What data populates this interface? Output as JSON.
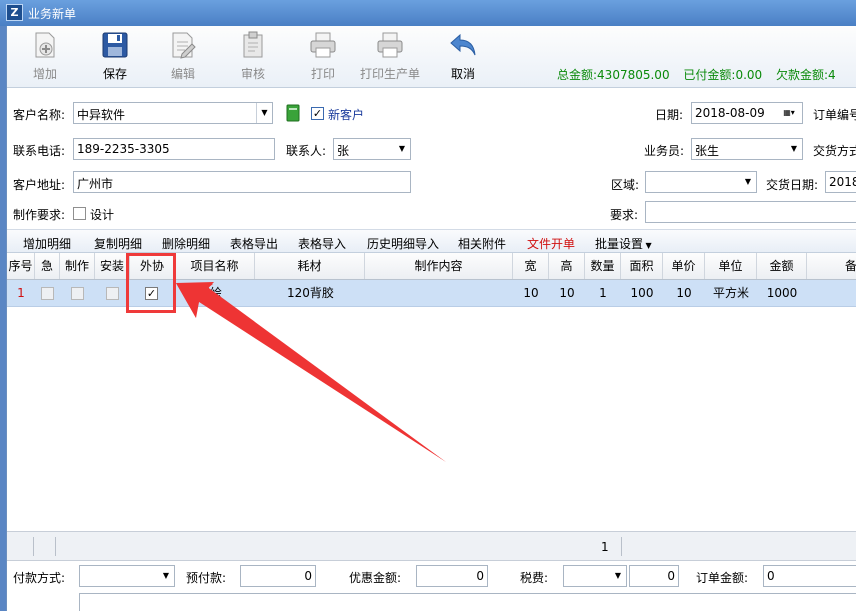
{
  "window": {
    "title": "业务新单",
    "app_icon": "Z"
  },
  "toolbar": {
    "add": "增加",
    "save": "保存",
    "edit": "编辑",
    "review": "审核",
    "print": "打印",
    "print_production": "打印生产单",
    "cancel": "取消"
  },
  "totals": {
    "total_label": "总金额:",
    "total_value": "4307805.00",
    "paid_label": "已付金额:",
    "paid_value": "0.00",
    "owed_label": "欠款金额:",
    "owed_value": "4"
  },
  "form": {
    "customer_name_label": "客户名称:",
    "customer_name": "中异软件",
    "new_customer_label": "新客户",
    "date_label": "日期:",
    "date": "2018-08-09",
    "order_no_label": "订单编号",
    "phone_label": "联系电话:",
    "phone": "189-2235-3305",
    "contact_label": "联系人:",
    "contact": "张",
    "salesman_label": "业务员:",
    "salesman": "张生",
    "delivery_method_label": "交货方式",
    "address_label": "客户地址:",
    "address": "广州市",
    "region_label": "区域:",
    "region": "",
    "delivery_date_label": "交货日期:",
    "delivery_date": "2018",
    "make_req_label": "制作要求:",
    "design_label": "设计",
    "requirement_label": "要求:",
    "requirement": ""
  },
  "subtoolbar": {
    "add_detail": "增加明细",
    "copy_detail": "复制明细",
    "delete_detail": "删除明细",
    "export_table": "表格导出",
    "import_table": "表格导入",
    "import_history": "历史明细导入",
    "attachments": "相关附件",
    "file_order": "文件开单",
    "batch_settings": "批量设置"
  },
  "grid": {
    "headers": {
      "seq": "序号",
      "urgent": "急",
      "make": "制作",
      "install": "安装",
      "outsource": "外协",
      "item": "项目名称",
      "material": "耗材",
      "content": "制作内容",
      "width": "宽",
      "height": "高",
      "qty": "数量",
      "area": "面积",
      "price": "单价",
      "unit": "单位",
      "amount": "金额",
      "remark": "备"
    },
    "rows": [
      {
        "seq": "1",
        "urgent": false,
        "make": false,
        "install": false,
        "outsource": true,
        "item": "喷绘",
        "material": "120背胶",
        "content": "",
        "width": "10",
        "height": "10",
        "qty": "1",
        "area": "100",
        "price": "10",
        "unit": "平方米",
        "amount": "1000"
      }
    ],
    "summary_qty": "1"
  },
  "footer": {
    "pay_method_label": "付款方式:",
    "pay_method": "",
    "prepaid_label": "预付款:",
    "prepaid": "0",
    "discount_label": "优惠金额:",
    "discount": "0",
    "tax_label": "税费:",
    "tax_type": "",
    "tax": "0",
    "order_amount_label": "订单金额:",
    "order_amount": "0"
  },
  "colors": {
    "title_bar": "#4a7fc4",
    "totals": "#0a8a0a",
    "highlight": "#ef3a3a",
    "selected_row": "#cde0f6",
    "red_item": "#d01010"
  }
}
